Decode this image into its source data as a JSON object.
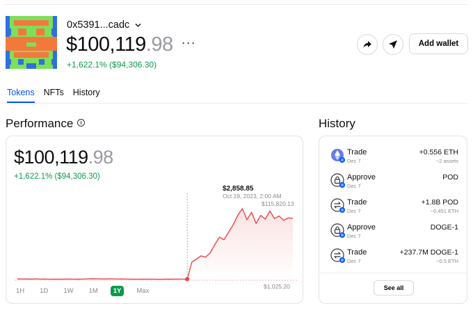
{
  "wallet": {
    "address": "0x5391...cadc",
    "balance_main": "$100,119",
    "balance_cents": ".98",
    "more_label": "···",
    "change": "+1,622.1% ($94,306.30)"
  },
  "actions": {
    "share_icon": "share-arrow-icon",
    "send_icon": "send-icon",
    "add_wallet_label": "Add wallet"
  },
  "tabs": [
    {
      "label": "Tokens",
      "active": true
    },
    {
      "label": "NFTs",
      "active": false
    },
    {
      "label": "History",
      "active": false
    }
  ],
  "performance": {
    "title": "Performance",
    "value_main": "$100,119",
    "value_cents": ".98",
    "change": "+1,622.1% ($94,306.30)",
    "colors": {
      "line": "#e5484d",
      "positive": "#0a9c4c",
      "tooltip_line": "#b0b0b0"
    },
    "tooltip_value": "$2,858.85",
    "tooltip_date": "Oct 19, 2023, 2:00 AM",
    "high_label": "$115,820.13",
    "low_label": "$1,025.20",
    "ranges": [
      {
        "label": "1H",
        "active": false
      },
      {
        "label": "1D",
        "active": false
      },
      {
        "label": "1W",
        "active": false
      },
      {
        "label": "1M",
        "active": false
      },
      {
        "label": "1Y",
        "active": true
      },
      {
        "label": "Max",
        "active": false
      }
    ]
  },
  "chart_data": {
    "type": "line",
    "title": "",
    "xlabel": "",
    "ylabel": "",
    "ylim": [
      1025.2,
      115820.13
    ],
    "series": [
      {
        "values": [
          3200,
          2900,
          3000,
          2700,
          3100,
          2800,
          2900,
          2600,
          2700,
          2800,
          2700,
          2900,
          2800,
          2700,
          2800,
          3000,
          3200,
          3400,
          3100,
          3000,
          3300,
          3100,
          2900,
          3000,
          2800,
          2700,
          2600,
          2700,
          2800,
          2700,
          2600,
          2500,
          2700,
          2800,
          2700,
          2900,
          2800,
          2858.85,
          30000,
          35000,
          40000,
          38000,
          45000,
          58000,
          70000,
          66000,
          78000,
          90000,
          105000,
          115820.13,
          98000,
          110000,
          92000,
          105000,
          99000,
          112000,
          100000,
          104000,
          97000,
          101000,
          100119.98
        ]
      }
    ]
  },
  "history": {
    "title": "History",
    "see_all": "See all",
    "items": [
      {
        "title": "Trade",
        "date": "Dec 7",
        "amount": "+0.556 ETH",
        "sub": "−2 assets",
        "icon": "eth-token-icon"
      },
      {
        "title": "Approve",
        "date": "Dec 7",
        "amount": "POD",
        "sub": "",
        "icon": "approve-lock-icon"
      },
      {
        "title": "Trade",
        "date": "Dec 7",
        "amount": "+1.8B POD",
        "sub": "−0.451 ETH",
        "icon": "trade-swap-icon"
      },
      {
        "title": "Approve",
        "date": "Dec 7",
        "amount": "DOGE-1",
        "sub": "",
        "icon": "approve-lock-icon"
      },
      {
        "title": "Trade",
        "date": "Dec 7",
        "amount": "+237.7M DOGE-1",
        "sub": "−0.5 ETH",
        "icon": "trade-swap-icon"
      }
    ]
  }
}
